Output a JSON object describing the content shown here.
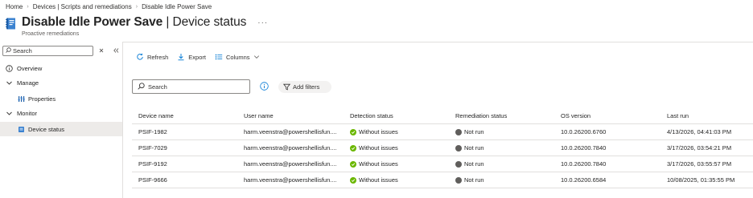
{
  "breadcrumb": [
    "Home",
    "Devices | Scripts and remediations",
    "Disable Idle Power Save"
  ],
  "header": {
    "title_bold": "Disable Idle Power Save",
    "title_rest": " | Device status",
    "subtitle": "Proactive remediations",
    "more": "···"
  },
  "sidebar": {
    "search_placeholder": "Search",
    "items": [
      {
        "label": "Overview",
        "icon": "info-circle-icon"
      },
      {
        "label": "Manage",
        "icon": "chevron-down-icon"
      },
      {
        "label": "Properties",
        "icon": "properties-icon"
      },
      {
        "label": "Monitor",
        "icon": "chevron-down-icon"
      },
      {
        "label": "Device status",
        "icon": "device-status-icon"
      }
    ]
  },
  "toolbar": {
    "refresh": "Refresh",
    "export": "Export",
    "columns": "Columns"
  },
  "filters": {
    "search_placeholder": "Search",
    "add_filters": "Add filters"
  },
  "table": {
    "columns": [
      "Device name",
      "User name",
      "Detection status",
      "Remediation status",
      "OS version",
      "Last run"
    ],
    "rows": [
      {
        "device": "PSIF-1982",
        "user": "harm.veenstra@powershellisfun....",
        "detection": "Without issues",
        "remediation": "Not run",
        "os": "10.0.26200.6760",
        "last_run": "4/13/2026, 04:41:03 PM"
      },
      {
        "device": "PSIF-7029",
        "user": "harm.veenstra@powershellisfun....",
        "detection": "Without issues",
        "remediation": "Not run",
        "os": "10.0.26200.7840",
        "last_run": "3/17/2026, 03:54:21 PM"
      },
      {
        "device": "PSIF-9192",
        "user": "harm.veenstra@powershellisfun....",
        "detection": "Without issues",
        "remediation": "Not run",
        "os": "10.0.26200.7840",
        "last_run": "3/17/2026, 03:55:57 PM"
      },
      {
        "device": "PSIF-9666",
        "user": "harm.veenstra@powershellisfun....",
        "detection": "Without issues",
        "remediation": "Not run",
        "os": "10.0.26200.6584",
        "last_run": "10/08/2025, 01:35:55 PM"
      }
    ]
  },
  "colors": {
    "accent": "#0078d4",
    "success": "#6bb700",
    "not_run": "#605e5c",
    "active_nav": "#edebe9"
  }
}
